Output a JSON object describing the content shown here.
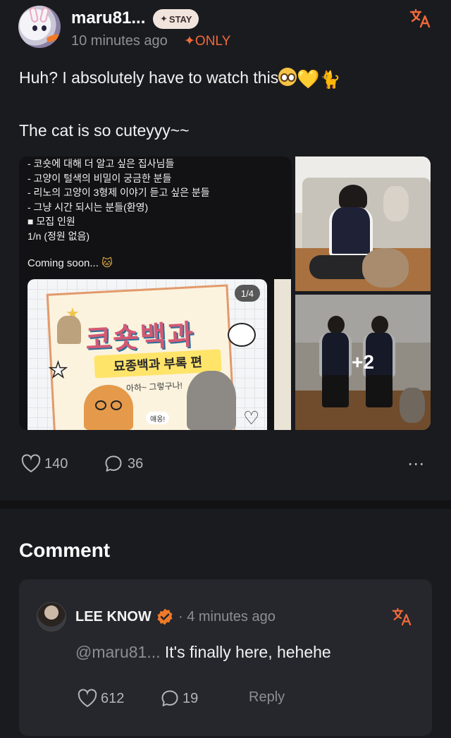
{
  "post": {
    "username": "maru81...",
    "badge": "STAY",
    "badge_prefix": "✦",
    "timestamp": "10 minutes ago",
    "only_label": "ONLY",
    "only_prefix": "✦",
    "text_line1": "Huh? I absolutely have to watch this",
    "text_line2": "The cat is so cuteyyy~~",
    "heart_emoji": "💛",
    "cat_emoji": "🐈",
    "media": {
      "notice_text": "- 코숏에 대해 더 알고 싶은 집사님들\n- 고양이 털색의 비밀이 궁금한 분들\n- 리노의 고양이 3형제 이야기 듣고 싶은 분들\n- 그냥 시간 되시는 분들(환영)\n■ 모집 인원\n1/n (정원 없음)",
      "coming_soon": "Coming soon...",
      "coming_emoji": "🐱",
      "card_counter": "1/4",
      "card_title": "코숏백과",
      "card_subtitle": "묘종백과 부록 편",
      "card_script": "아하~ 그렇구나!",
      "card_label": "얘옹!",
      "more_count": "+2"
    },
    "likes": "140",
    "comments": "36",
    "more_icon": "⋯"
  },
  "comment_section": {
    "heading": "Comment"
  },
  "comment": {
    "name": "LEE KNOW",
    "time": "· 4 minutes ago",
    "mention": "@maru81...",
    "body": " It's finally here, hehehe",
    "likes": "612",
    "replies": "19",
    "reply_label": "Reply"
  },
  "colors": {
    "accent": "#f06a3a",
    "background": "#1a1b1f",
    "card": "#26272c"
  },
  "icons": [
    "translate-icon",
    "heart-icon",
    "comment-icon",
    "more-icon",
    "verified-icon"
  ]
}
